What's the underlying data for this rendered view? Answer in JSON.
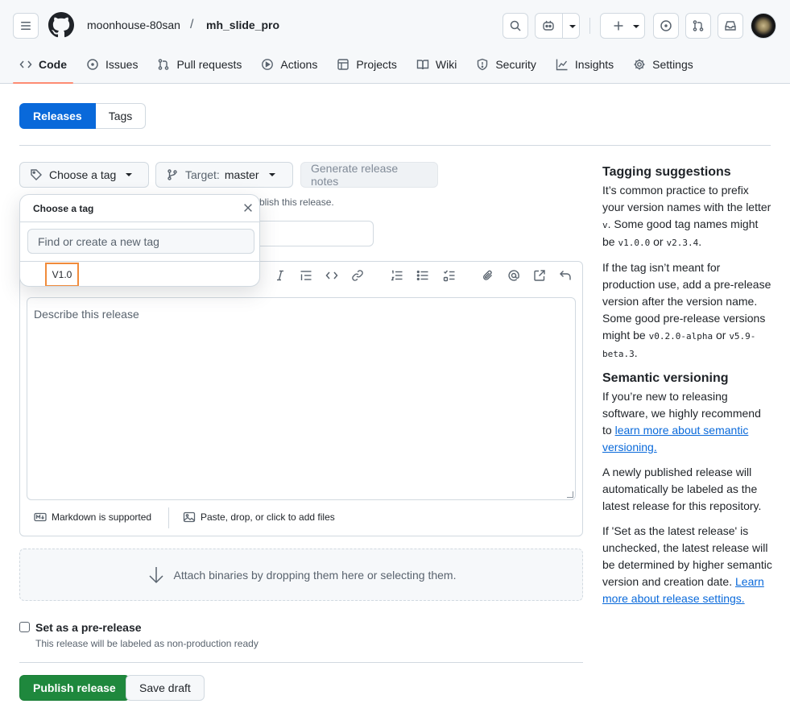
{
  "header": {
    "owner": "moonhouse-80san",
    "slash": "/",
    "repo": "mh_slide_pro"
  },
  "nav": [
    {
      "label": "Code",
      "icon": "code-icon"
    },
    {
      "label": "Issues",
      "icon": "issue-icon"
    },
    {
      "label": "Pull requests",
      "icon": "pull-request-icon"
    },
    {
      "label": "Actions",
      "icon": "play-icon"
    },
    {
      "label": "Projects",
      "icon": "table-icon"
    },
    {
      "label": "Wiki",
      "icon": "book-icon"
    },
    {
      "label": "Security",
      "icon": "shield-icon"
    },
    {
      "label": "Insights",
      "icon": "graph-icon"
    },
    {
      "label": "Settings",
      "icon": "gear-icon"
    }
  ],
  "tabs": {
    "releases": "Releases",
    "tags": "Tags"
  },
  "form": {
    "choose_tag": "Choose a tag",
    "target_label": "Target:",
    "target_value": "master",
    "generate_notes": "Generate release notes",
    "hint_partial": "blish this release.",
    "textarea_placeholder": "Describe this release",
    "markdown_note": "Markdown is supported",
    "paste_note": "Paste, drop, or click to add files",
    "attach": "Attach binaries by dropping them here or selecting them.",
    "prerelease_label": "Set as a pre-release",
    "prerelease_note": "This release will be labeled as non-production ready",
    "publish": "Publish release",
    "save_draft": "Save draft"
  },
  "popover": {
    "title": "Choose a tag",
    "placeholder": "Find or create a new tag",
    "items": [
      "V1.0"
    ]
  },
  "sidebar": {
    "tagging_title": "Tagging suggestions",
    "p1_a": "It’s common practice to prefix your version names with the letter ",
    "p1_v": "v",
    "p1_b": ". Some good tag names might be ",
    "p1_c1": "v1.0.0",
    "p1_or": " or ",
    "p1_c2": "v2.3.4",
    "p1_end": ".",
    "p2_a": "If the tag isn’t meant for production use, add a pre-release version after the version name. Some good pre-release versions might be ",
    "p2_c1": "v0.2.0-alpha",
    "p2_or": " or ",
    "p2_c2": "v5.9-beta.3",
    "p2_end": ".",
    "semver_title": "Semantic versioning",
    "p3_a": "If you’re new to releasing software, we highly recommend to ",
    "p3_link": "learn more about semantic versioning.",
    "p4": "A newly published release will automatically be labeled as the latest release for this repository.",
    "p5_a": "If 'Set as the latest release' is unchecked, the latest release will be determined by higher semantic version and creation date. ",
    "p5_link": "Learn more about release settings."
  }
}
